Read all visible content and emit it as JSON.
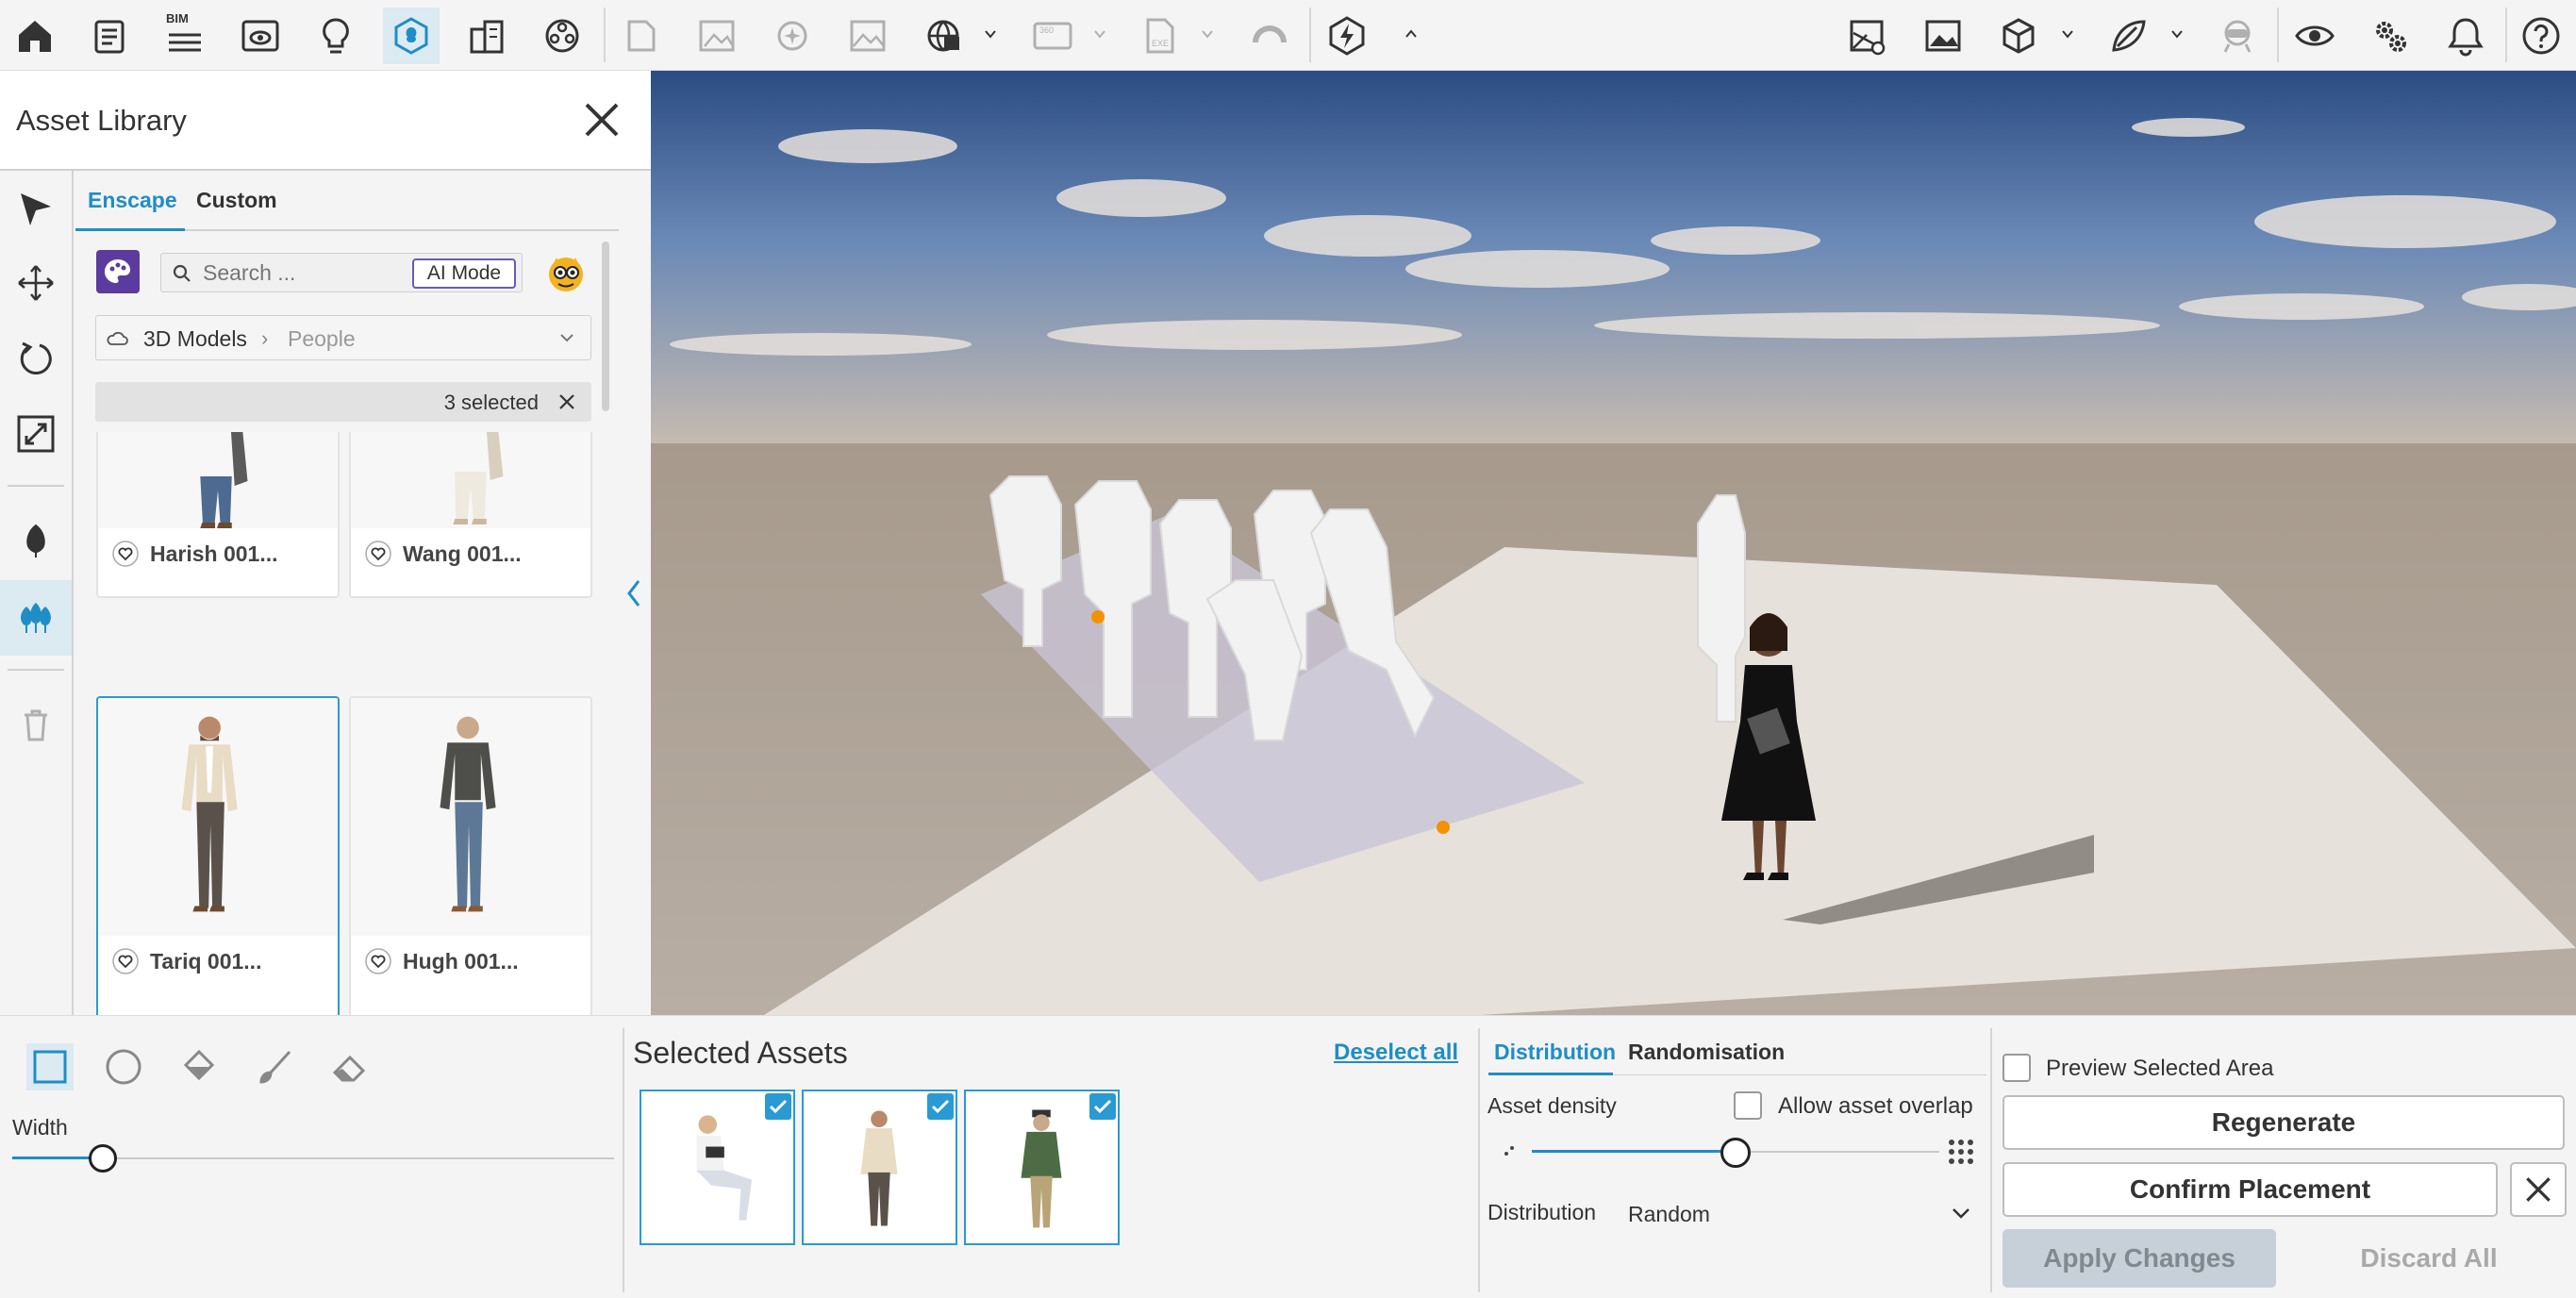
{
  "toolbar": {
    "bim_label": "BIM",
    "icons": [
      "home-icon",
      "document-icon",
      "bim-icon",
      "preview-window-icon",
      "light-bulb-icon",
      "asset-library-icon",
      "site-context-icon",
      "material-editor-icon",
      "capture-edit-icon",
      "batch-render-icon",
      "ai-enhance-icon",
      "image-icon",
      "export-icon",
      "panorama-icon",
      "exe-export-icon",
      "web-standalone-icon",
      "upload-icon",
      "collapse-icon",
      "atmosphere-icon",
      "image-settings-icon",
      "model-icon",
      "object-icon",
      "vr-icon",
      "visibility-icon",
      "settings-icon",
      "notification-icon",
      "help-icon"
    ]
  },
  "library": {
    "title": "Asset Library",
    "tabs": [
      "Enscape",
      "Custom"
    ],
    "active_tab": "Enscape",
    "search_placeholder": "Search ...",
    "ai_mode_label": "AI Mode",
    "breadcrumb": {
      "root": "3D Models",
      "separator": "›",
      "current": "People"
    },
    "selection": {
      "text": "3 selected"
    },
    "cards": [
      {
        "name": "Harish 001...",
        "selected": false
      },
      {
        "name": "Wang 001...",
        "selected": false
      },
      {
        "name": "Tariq 001...",
        "selected": true
      },
      {
        "name": "Hugh 001...",
        "selected": false
      }
    ],
    "tools": [
      "select-icon",
      "move-icon",
      "rotate-icon",
      "scale-icon",
      "place-single-icon",
      "place-multiple-icon",
      "delete-icon"
    ]
  },
  "brush": {
    "shapes": [
      "rectangle-icon",
      "circle-icon",
      "fill-icon",
      "brush-icon",
      "eraser-icon"
    ],
    "width_label": "Width",
    "width_value": 0.15
  },
  "selected_assets": {
    "title": "Selected Assets",
    "deselect_label": "Deselect all",
    "items": [
      "sitting-woman",
      "standing-man-beard",
      "man-cap-plaid"
    ]
  },
  "distribution": {
    "tabs": [
      "Distribution",
      "Randomisation"
    ],
    "active_tab": "Distribution",
    "density_label": "Asset density",
    "density_value": 0.5,
    "overlap_label": "Allow asset overlap",
    "distribution_label": "Distribution",
    "distribution_value": "Random"
  },
  "actions": {
    "preview_label": "Preview Selected Area",
    "regenerate_label": "Regenerate",
    "confirm_label": "Confirm Placement",
    "apply_label": "Apply Changes",
    "discard_label": "Discard All"
  },
  "colors": {
    "accent": "#1f8dc6",
    "brand_purple": "#5b3c9e"
  }
}
